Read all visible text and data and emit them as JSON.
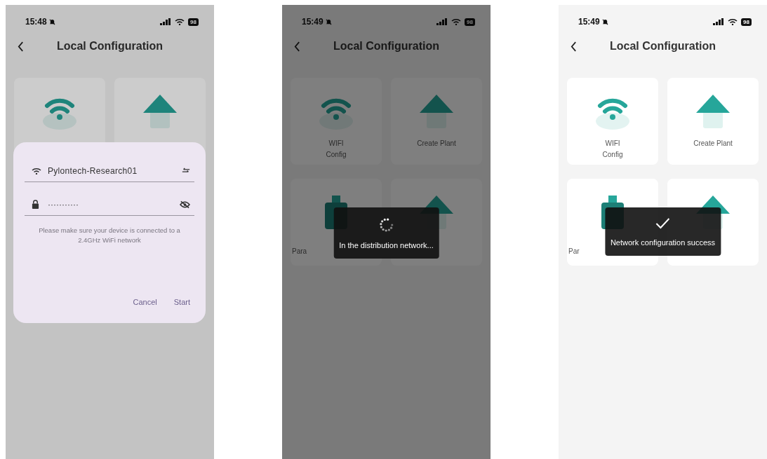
{
  "screens": [
    {
      "time": "15:48",
      "battery": "98",
      "title": "Local Configuration",
      "dimmed": true,
      "cards": [
        {
          "kind": "wifi"
        },
        {
          "kind": "house"
        }
      ],
      "dialog": {
        "network": "Pylontech-Research01",
        "password_mask": "···········",
        "hint": "Please make sure your device is connected to a 2.4GHz WiFi network",
        "buttons": [
          "Cancel",
          "Start"
        ]
      }
    },
    {
      "time": "15:49",
      "battery": "98",
      "title": "Local Configuration",
      "dimmed": true,
      "cards": [
        {
          "kind": "wifi",
          "label": "WIFI\nConfig"
        },
        {
          "kind": "house",
          "label": "Create Plant"
        },
        {
          "kind": "device",
          "label": "Para"
        },
        {
          "kind": "house"
        }
      ],
      "toast": {
        "kind": "loading",
        "text": "In the distribution network..."
      }
    },
    {
      "time": "15:49",
      "battery": "98",
      "title": "Local Configuration",
      "dimmed": false,
      "cards": [
        {
          "kind": "wifi",
          "label": "WIFI\nConfig"
        },
        {
          "kind": "house",
          "label": "Create Plant"
        },
        {
          "kind": "device",
          "label": "Par"
        },
        {
          "kind": "house"
        }
      ],
      "toast": {
        "kind": "success",
        "text": "Network configuration success"
      }
    }
  ]
}
